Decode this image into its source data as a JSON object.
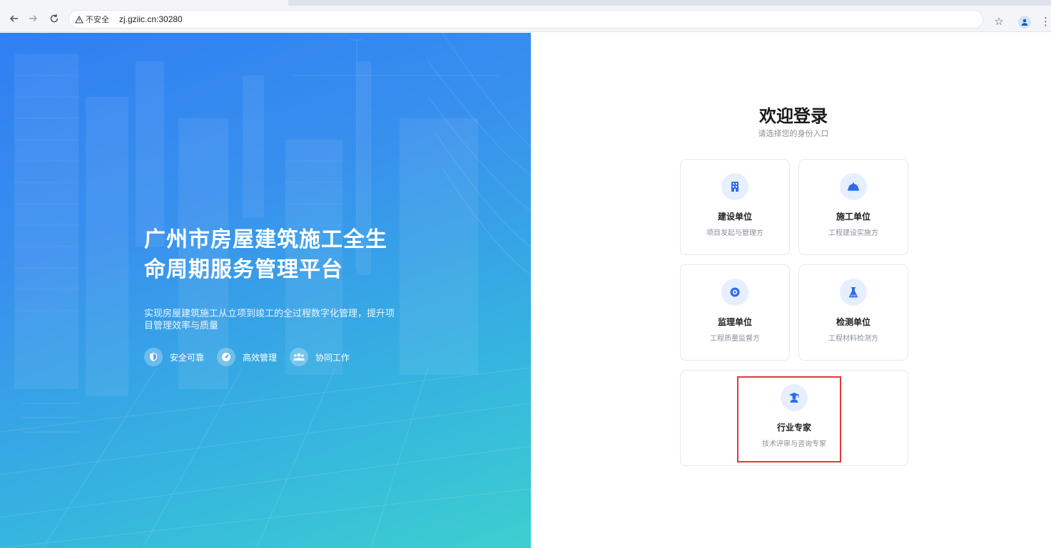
{
  "browser": {
    "security_label": "不安全",
    "url": "zj.gziic.cn:30280"
  },
  "hero": {
    "title": "广州市房屋建筑施工全生命周期服务管理平台",
    "subtitle": "实现房屋建筑施工从立项到竣工的全过程数字化管理，提升项目管理效率与质量",
    "features": [
      {
        "icon": "shield-icon",
        "label": "安全可靠"
      },
      {
        "icon": "gauge-icon",
        "label": "高效管理"
      },
      {
        "icon": "users-icon",
        "label": "协同工作"
      }
    ]
  },
  "login": {
    "title": "欢迎登录",
    "subtitle": "请选择您的身份入口",
    "roles": [
      {
        "icon": "building-icon",
        "name": "建设单位",
        "desc": "项目发起与管理方"
      },
      {
        "icon": "hardhat-icon",
        "name": "施工单位",
        "desc": "工程建设实施方"
      },
      {
        "icon": "eye-icon",
        "name": "监理单位",
        "desc": "工程质量监督方"
      },
      {
        "icon": "flask-icon",
        "name": "检测单位",
        "desc": "工程材料检测方"
      },
      {
        "icon": "graduate-icon",
        "name": "行业专家",
        "desc": "技术评审与咨询专家"
      }
    ]
  },
  "colors": {
    "accent": "#2f6bea",
    "icon_bg": "#e6efff",
    "highlight": "#e0393e",
    "hero_start": "#2f7ff2",
    "hero_end": "#3dcfcf"
  }
}
